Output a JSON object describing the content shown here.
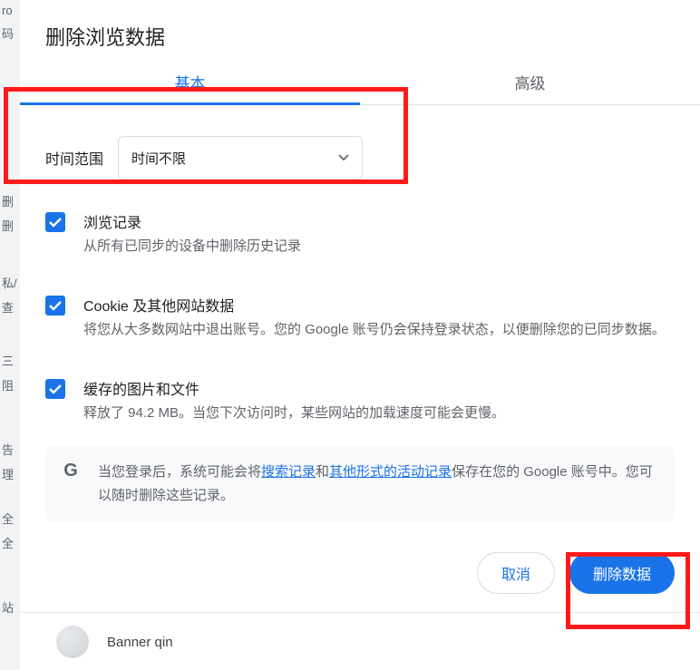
{
  "dialog": {
    "title": "删除浏览数据"
  },
  "tabs": {
    "basic": "基本",
    "advanced": "高级"
  },
  "time": {
    "label": "时间范围",
    "selected": "时间不限"
  },
  "options": {
    "history": {
      "title": "浏览记录",
      "desc": "从所有已同步的设备中删除历史记录"
    },
    "cookies": {
      "title": "Cookie 及其他网站数据",
      "desc": "将您从大多数网站中退出账号。您的 Google 账号仍会保持登录状态，以便删除您的已同步数据。"
    },
    "cache": {
      "title": "缓存的图片和文件",
      "desc": "释放了 94.2 MB。当您下次访问时，某些网站的加载速度可能会更慢。"
    }
  },
  "notice": {
    "pre": "当您登录后，系统可能会将",
    "link1": "搜索记录",
    "and": "和",
    "link2": "其他形式的活动记录",
    "post": "保存在您的 Google 账号中。您可以随时删除这些记录。"
  },
  "buttons": {
    "cancel": "取消",
    "confirm": "删除数据"
  },
  "account": {
    "name": "Banner qin"
  },
  "left_strip": {
    "a": "ro",
    "b": "码",
    "c": "删",
    "d": "删",
    "e": "私/",
    "f": "查",
    "g": "三",
    "h": "阻",
    "i": "告",
    "j": "理",
    "k": "全",
    "l": "全",
    "m": "站"
  }
}
